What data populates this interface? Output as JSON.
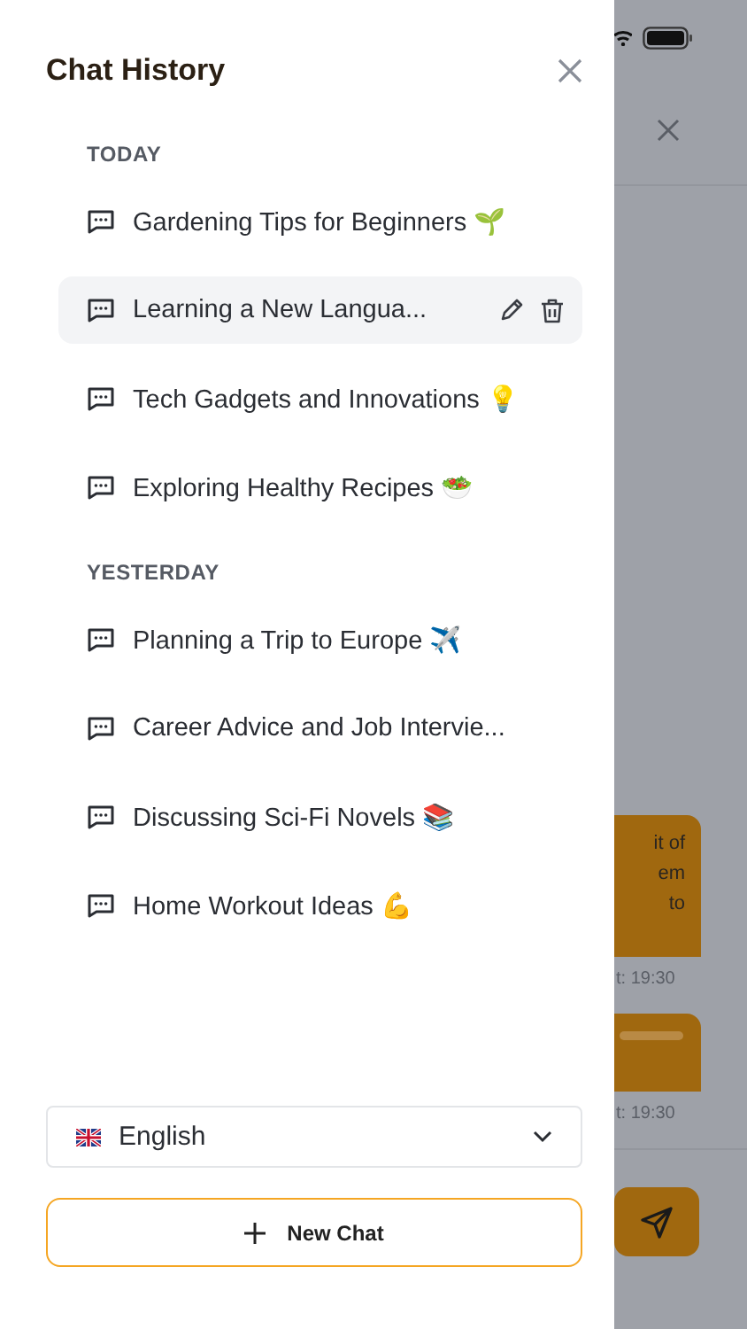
{
  "drawer": {
    "title": "Chat History",
    "sections": [
      {
        "label": "TODAY",
        "items": [
          {
            "title": "Gardening Tips for Beginners 🌱",
            "selected": false
          },
          {
            "title": "Learning a New Langua...",
            "selected": true
          },
          {
            "title": "Tech Gadgets and Innovations 💡",
            "selected": false
          },
          {
            "title": "Exploring Healthy Recipes 🥗",
            "selected": false
          }
        ]
      },
      {
        "label": "YESTERDAY",
        "items": [
          {
            "title": "Planning a Trip to Europe ✈️",
            "selected": false
          },
          {
            "title": "Career Advice and Job Intervie...",
            "selected": false
          },
          {
            "title": "Discussing Sci-Fi Novels 📚",
            "selected": false
          },
          {
            "title": "Home Workout Ideas 💪",
            "selected": false
          }
        ]
      }
    ],
    "language": {
      "value": "English"
    },
    "new_chat_button": "New Chat"
  },
  "background": {
    "messages": [
      {
        "lines": [
          "it of",
          "em",
          "to"
        ],
        "time": "t: 19:30"
      },
      {
        "time": "t: 19:30"
      }
    ]
  }
}
